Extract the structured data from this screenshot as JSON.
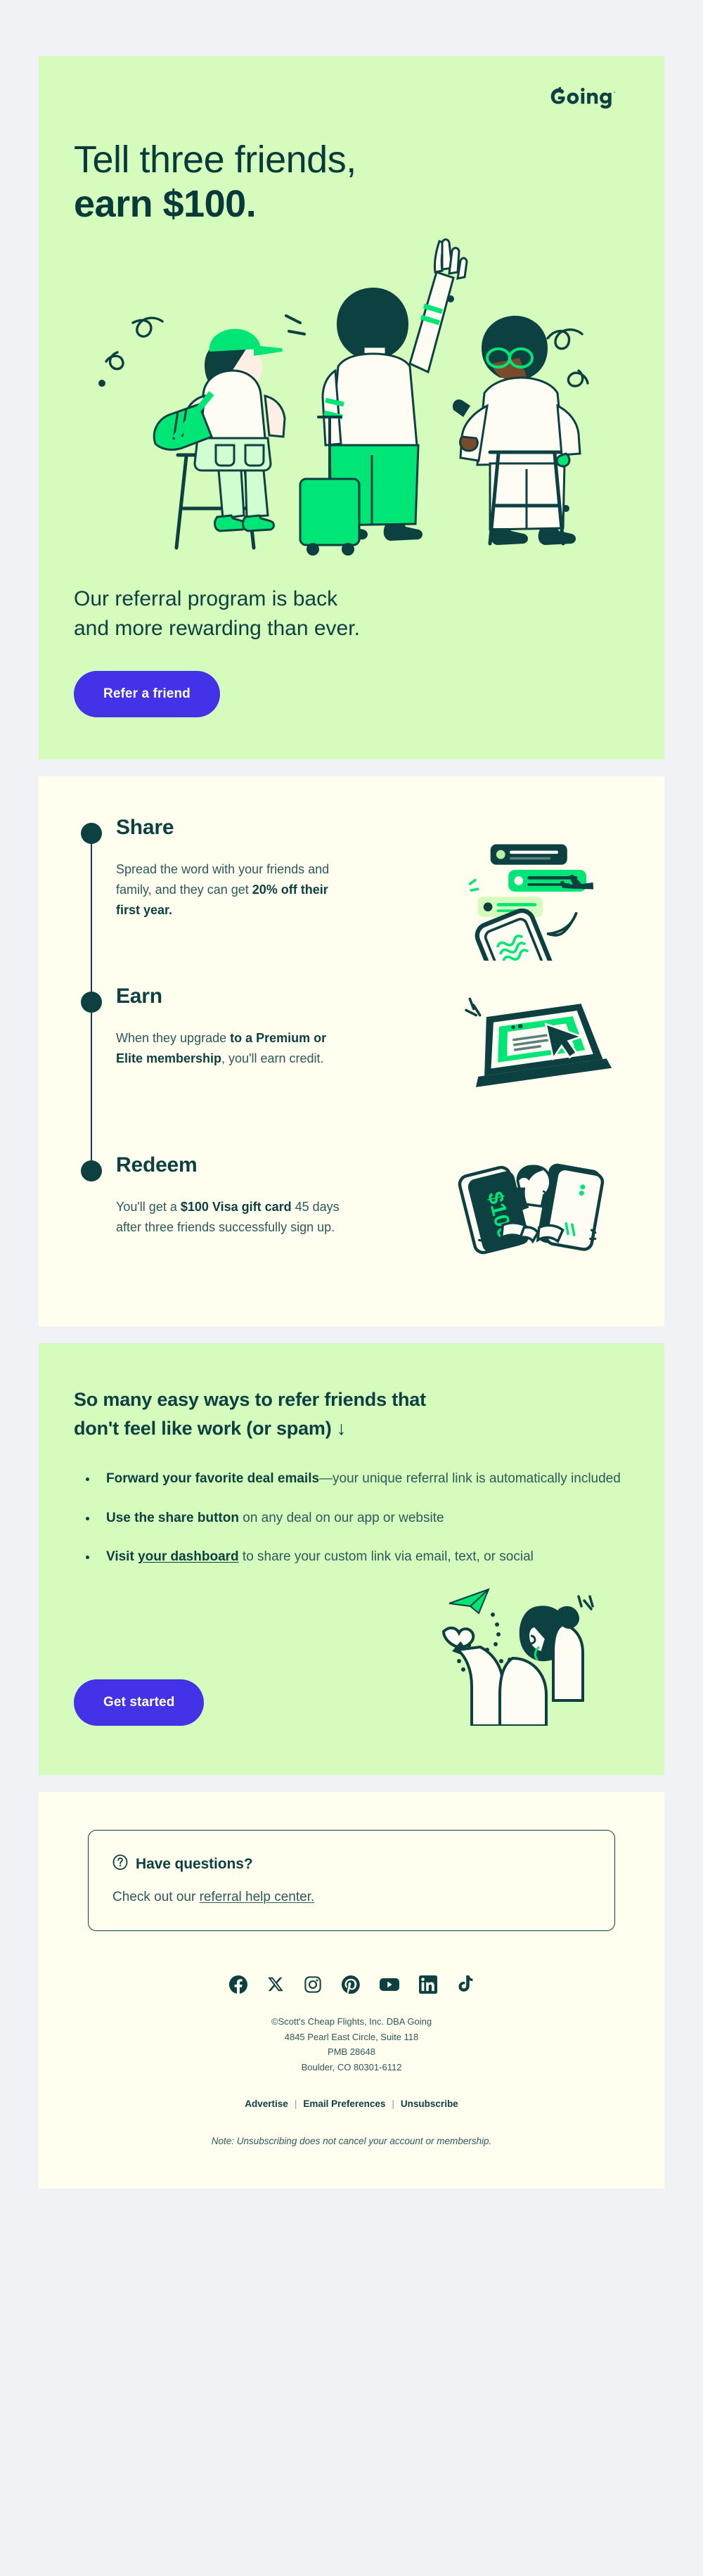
{
  "brand": {
    "logo_text": "Going",
    "accent_green": "#00e676",
    "dark_green": "#0d4040",
    "hero_bg": "#d6fcbd",
    "cream_bg": "#fffeef",
    "page_bg": "#f1f2f6",
    "cta_purple": "#4432e8"
  },
  "hero": {
    "title_line1": "Tell three friends,",
    "title_line2": "earn $100.",
    "subtitle_line1": "Our referral program is back",
    "subtitle_line2": "and more rewarding than ever.",
    "cta_label": "Refer a friend",
    "art_alt": "three-travelers-illustration"
  },
  "steps": [
    {
      "title": "Share",
      "body_pre": "Spread the word with your friends and family, and they can get ",
      "body_bold": "20% off their first year.",
      "body_post": "",
      "art_alt": "phone-with-chat-bubbles-illustration"
    },
    {
      "title": "Earn",
      "body_pre": "When they upgrade ",
      "body_bold": "to a Premium or Elite membership",
      "body_post": ", you'll earn credit.",
      "art_alt": "laptop-with-cursor-illustration"
    },
    {
      "title": "Redeem",
      "body_pre": "You'll get a ",
      "body_bold": "$100 Visa gift card",
      "body_post": " 45 days after three friends successfully sign up.",
      "art_alt": "person-holding-gift-card-illustration"
    }
  ],
  "ways": {
    "title_line1": "So many easy ways to refer friends that",
    "title_line2": "don't feel like work (or spam)",
    "title_arrow": "↓",
    "bullets": [
      {
        "bold": "Forward your favorite deal emails",
        "rest": "—your unique referral link is automatically included",
        "link": false
      },
      {
        "bold": "Use the share button",
        "rest": " on any deal on our app or website",
        "link": false
      },
      {
        "bold_plain": "Visit ",
        "bold_link": "your dashboard",
        "rest": " to share your custom link via email, text, or social",
        "link": true
      }
    ],
    "cta_label": "Get started",
    "art_alt": "person-with-paper-plane-illustration"
  },
  "questions": {
    "icon": "question-circle-icon",
    "heading": "Have questions?",
    "sub_pre": "Check out our ",
    "sub_link": "referral help center."
  },
  "socials": [
    {
      "name": "facebook-icon",
      "label": "Facebook"
    },
    {
      "name": "x-twitter-icon",
      "label": "X"
    },
    {
      "name": "instagram-icon",
      "label": "Instagram"
    },
    {
      "name": "pinterest-icon",
      "label": "Pinterest"
    },
    {
      "name": "youtube-icon",
      "label": "YouTube"
    },
    {
      "name": "linkedin-icon",
      "label": "LinkedIn"
    },
    {
      "name": "tiktok-icon",
      "label": "TikTok"
    }
  ],
  "legal": {
    "line1": "©Scott's Cheap Flights, Inc. DBA Going",
    "line2": "4845 Pearl East Circle, Suite 118",
    "line3": "PMB 28648",
    "line4": "Boulder, CO 80301-6112"
  },
  "footer_links": {
    "advertise": "Advertise",
    "email_prefs": "Email Preferences",
    "unsubscribe": "Unsubscribe",
    "separator": "|"
  },
  "note": "Note: Unsubscribing does not cancel your account or membership."
}
